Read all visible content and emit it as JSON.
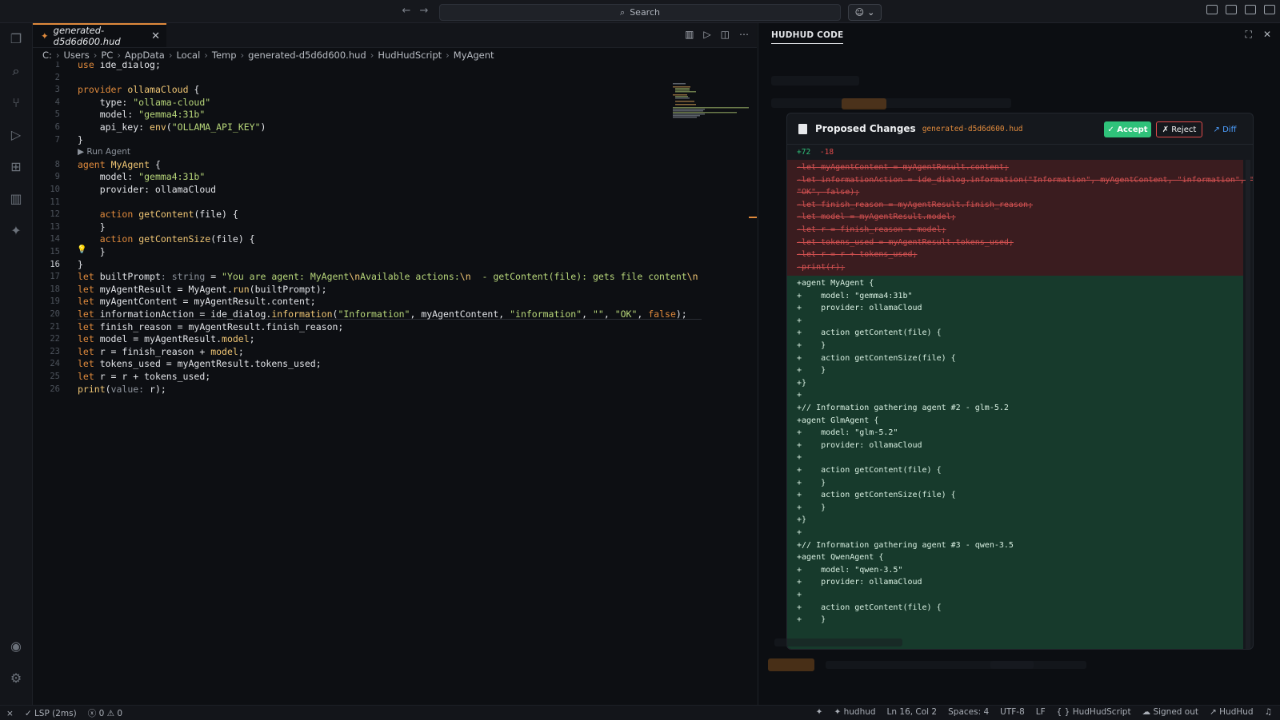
{
  "titlebar": {
    "back_icon": "arrow-left-icon",
    "forward_icon": "arrow-right-icon",
    "search_placeholder": "Search"
  },
  "editor": {
    "tab_label": "generated-d5d6d600.hud",
    "breadcrumb": [
      "C:",
      "Users",
      "PC",
      "AppData",
      "Local",
      "Temp",
      "generated-d5d6d600.hud",
      "HudHudScript",
      "MyAgent"
    ],
    "codelens_run": "▶ Run Agent",
    "lines": [
      {
        "n": "1",
        "html": "<span class=\"kw\">use</span> ide_dialog;"
      },
      {
        "n": "2",
        "html": ""
      },
      {
        "n": "3",
        "html": "<span class=\"kw\">provider</span> <span class=\"fn\">ollamaCloud</span> {"
      },
      {
        "n": "4",
        "html": "    type: <span class=\"str\">\"ollama-cloud\"</span>"
      },
      {
        "n": "5",
        "html": "    model: <span class=\"str\">\"gemma4:31b\"</span>"
      },
      {
        "n": "6",
        "html": "    api_key: <span class=\"fn\">env</span>(<span class=\"str\">\"OLLAMA_API_KEY\"</span>)"
      },
      {
        "n": "7",
        "html": "}"
      },
      {
        "n": "8",
        "html": "<span class=\"kw\">agent</span> <span class=\"fn\">MyAgent</span> {"
      },
      {
        "n": "9",
        "html": "    model: <span class=\"str\">\"gemma4:31b\"</span>"
      },
      {
        "n": "10",
        "html": "    provider: ollamaCloud"
      },
      {
        "n": "11",
        "html": ""
      },
      {
        "n": "12",
        "html": "    <span class=\"kw\">action</span> <span class=\"fn\">getContent</span>(file) {"
      },
      {
        "n": "13",
        "html": "    }"
      },
      {
        "n": "14",
        "html": "    <span class=\"kw\">action</span> <span class=\"fn\">getContenSize</span>(file) {"
      },
      {
        "n": "15",
        "html": "    }"
      },
      {
        "n": "16",
        "html": "}"
      },
      {
        "n": "17",
        "html": "<span class=\"kw\">let</span> builtPrompt<span class=\"typ\">: string</span> = <span class=\"str\">\"You are agent: MyAgent</span><span class=\"fn\">\\n</span><span class=\"str\">Available actions:</span><span class=\"fn\">\\n</span><span class=\"str\">  - getContent(file): gets file content</span><span class=\"fn\">\\n</span>"
      },
      {
        "n": "18",
        "html": "<span class=\"kw\">let</span> myAgentResult = MyAgent.<span class=\"fn\">run</span>(builtPrompt);"
      },
      {
        "n": "19",
        "html": "<span class=\"kw\">let</span> myAgentContent = myAgentResult.content;"
      },
      {
        "n": "20",
        "html": "<span class=\"kw\">let</span> informationAction = ide_dialog.<span class=\"fn\">information</span>(<span class=\"str\">\"Information\"</span>, myAgentContent, <span class=\"str\">\"information\"</span>, <span class=\"str\">\"\"</span>, <span class=\"str\">\"OK\"</span>, <span class=\"kw\">false</span>);"
      },
      {
        "n": "21",
        "html": "<span class=\"kw\">let</span> finish_reason = myAgentResult.finish_reason;"
      },
      {
        "n": "22",
        "html": "<span class=\"kw\">let</span> model = myAgentResult.<span class=\"fn\">model</span>;"
      },
      {
        "n": "23",
        "html": "<span class=\"kw\">let</span> r = finish_reason + <span class=\"fn\">model</span>;"
      },
      {
        "n": "24",
        "html": "<span class=\"kw\">let</span> tokens_used = myAgentResult.tokens_used;"
      },
      {
        "n": "25",
        "html": "<span class=\"kw\">let</span> r = r + tokens_used;"
      },
      {
        "n": "26",
        "html": "<span class=\"fn\">print</span>(<span class=\"typ\">value:</span> r);"
      }
    ]
  },
  "panel": {
    "title": "HUDHUD CODE",
    "changes": {
      "title": "Proposed Changes",
      "file": "generated-d5d6d600.hud",
      "accept": "✓ Accept",
      "reject": "✗ Reject",
      "diff": "↗ Diff",
      "added": "+72",
      "removed": "-18",
      "deleted_lines": [
        "-let myAgentContent = myAgentResult.content;",
        "-let informationAction = ide_dialog.information(\"Information\", myAgentContent, \"information\", \"\",",
        "\"OK\", false);",
        "-let finish_reason = myAgentResult.finish_reason;",
        "-let model = myAgentResult.model;",
        "-let r = finish_reason + model;",
        "-let tokens_used = myAgentResult.tokens_used;",
        "-let r = r + tokens_used;",
        "-print(r);"
      ],
      "added_lines": [
        "+agent MyAgent {",
        "+    model: \"gemma4:31b\"",
        "+    provider: ollamaCloud",
        "+",
        "+    action getContent(file) {",
        "+    }",
        "+    action getContenSize(file) {",
        "+    }",
        "+}",
        "+",
        "+// Information gathering agent #2 - glm-5.2",
        "+agent GlmAgent {",
        "+    model: \"glm-5.2\"",
        "+    provider: ollamaCloud",
        "+",
        "+    action getContent(file) {",
        "+    }",
        "+    action getContenSize(file) {",
        "+    }",
        "+}",
        "+",
        "+// Information gathering agent #3 - qwen-3.5",
        "+agent QwenAgent {",
        "+    model: \"qwen-3.5\"",
        "+    provider: ollamaCloud",
        "+",
        "+    action getContent(file) {",
        "+    }"
      ]
    }
  },
  "statusbar": {
    "lsp": "LSP (2ms)",
    "errors": "0",
    "warnings": "0",
    "project": "hudhud",
    "position": "Ln 16, Col 2",
    "spaces": "Spaces: 4",
    "encoding": "UTF-8",
    "eol": "LF",
    "language": "HudHudScript",
    "account": "Signed out",
    "extension": "HudHud"
  },
  "colors": {
    "accent": "#e08a3c",
    "accept": "#2fc27a",
    "reject": "#e24b4b",
    "diff_link": "#4d9fff"
  }
}
